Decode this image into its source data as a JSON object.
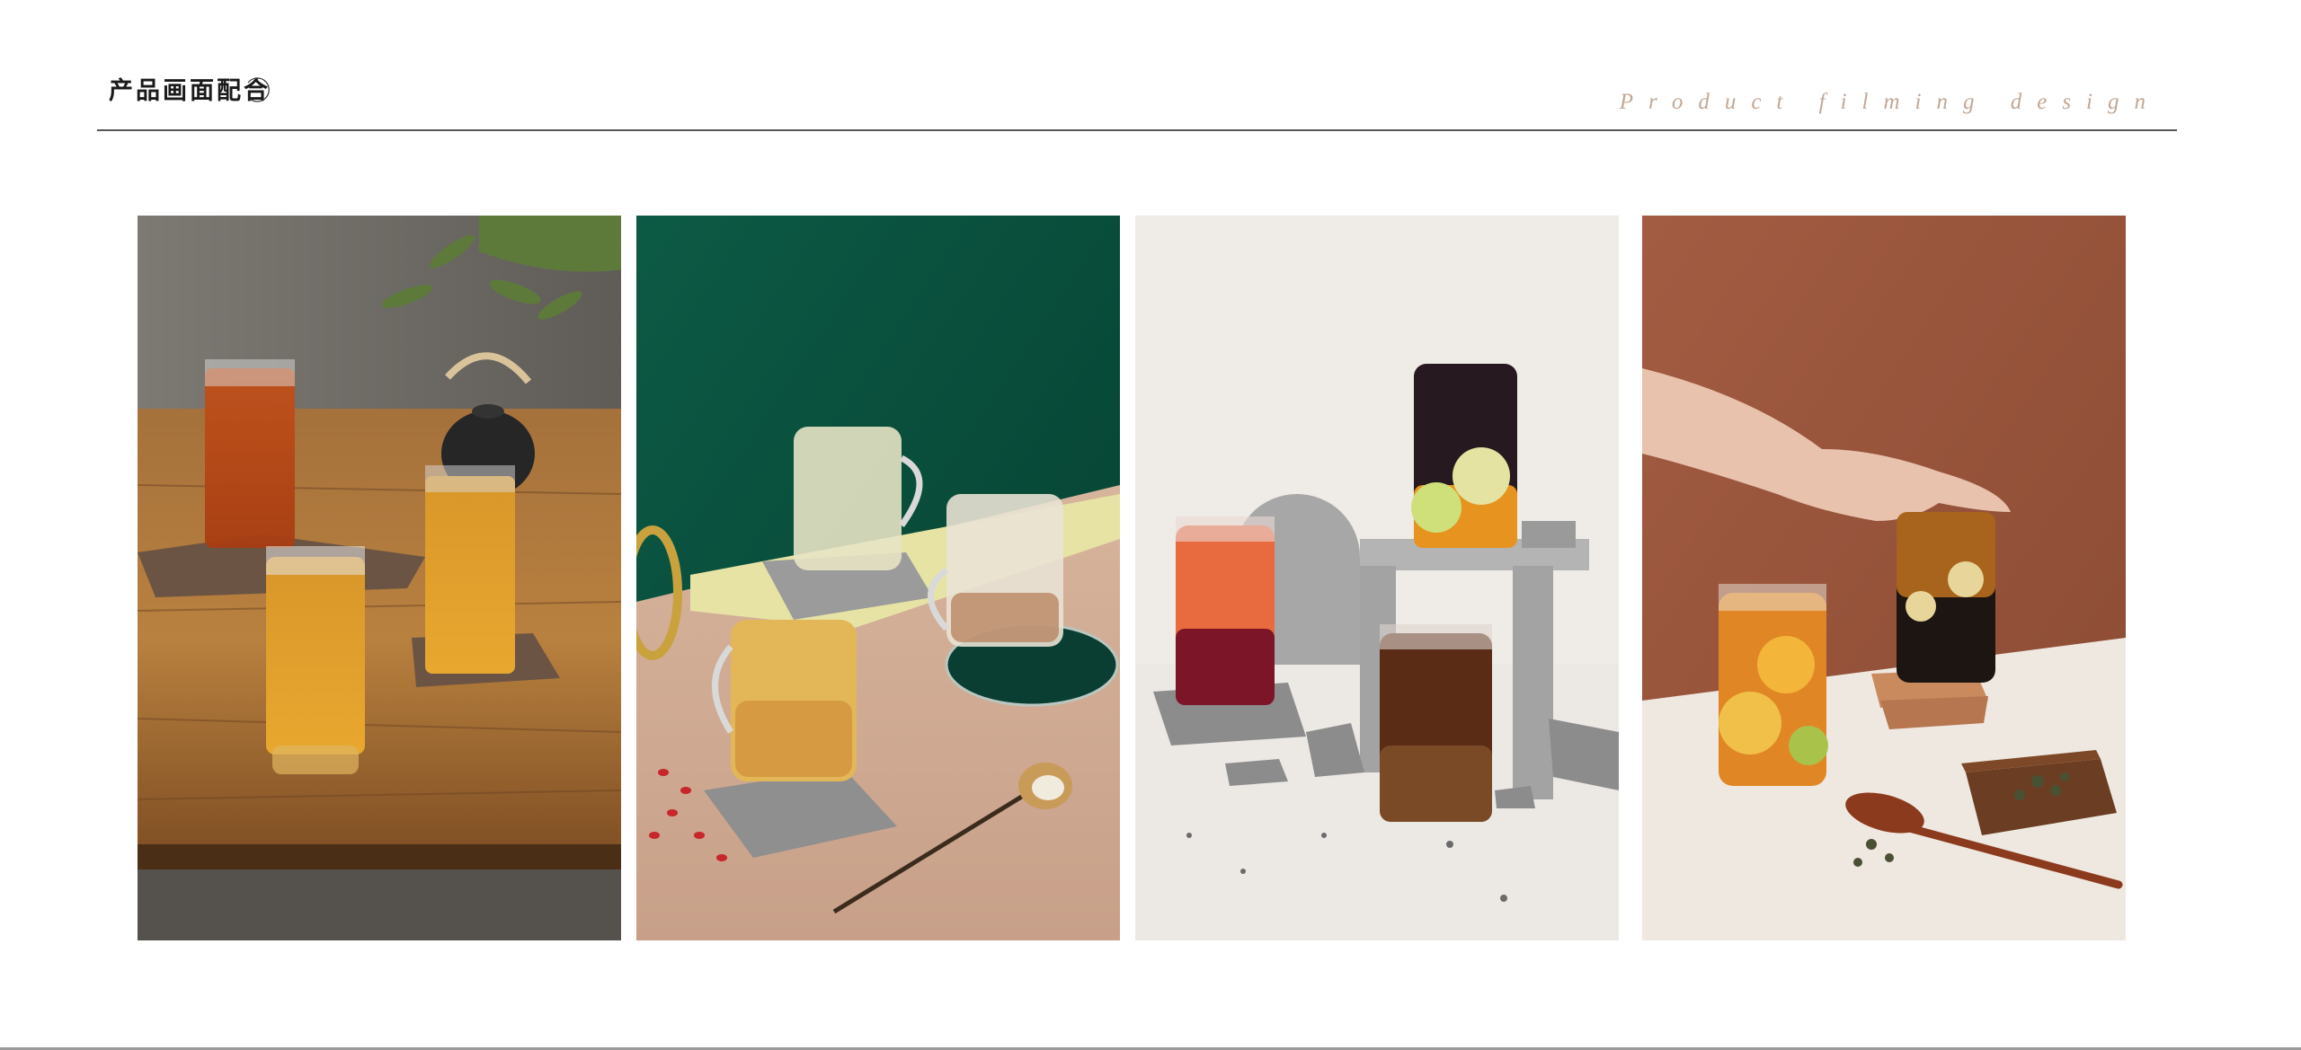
{
  "header": {
    "title_cn": "产品画面配合",
    "title_en": "Product filming design"
  },
  "photos": [
    {
      "icon": "tea-glasses-on-wooden-table-photo"
    },
    {
      "icon": "glass-mugs-on-green-background-photo"
    },
    {
      "icon": "iced-drinks-on-stone-blocks-photo"
    },
    {
      "icon": "hand-with-lemon-tea-on-brown-background-photo"
    }
  ],
  "colors": {
    "title": "#1a1a1a",
    "subtitle": "#c2a895",
    "rule": "#555555"
  }
}
